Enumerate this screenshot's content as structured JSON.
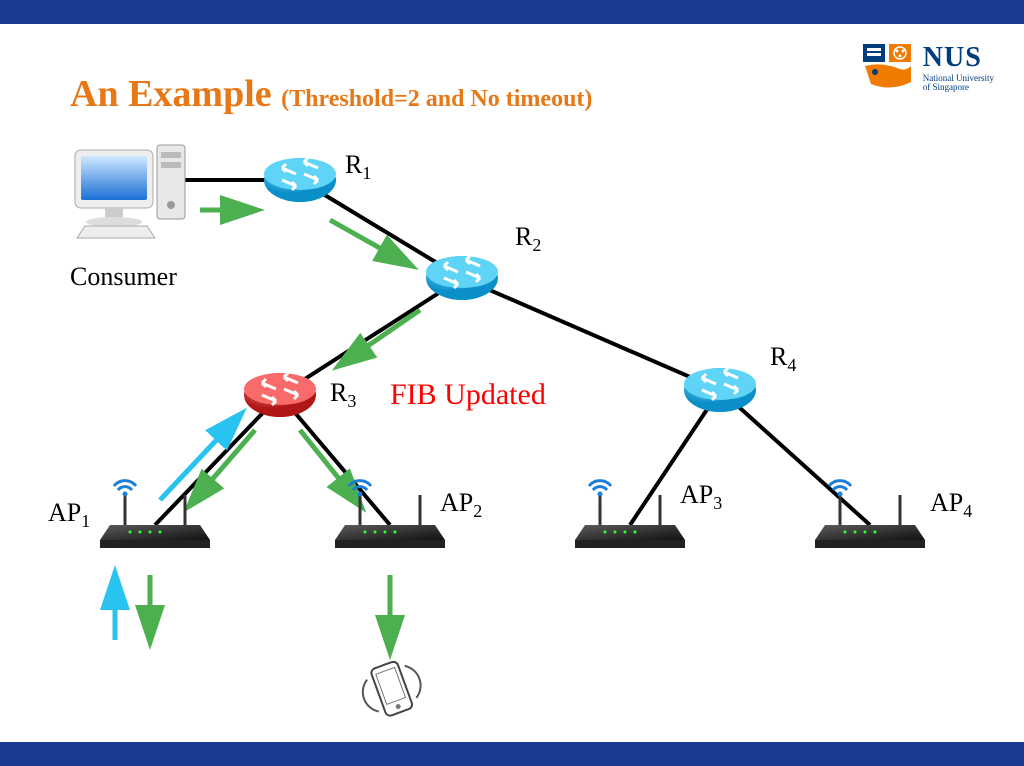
{
  "title": {
    "main": "An Example",
    "sub": "(Threshold=2 and No timeout)"
  },
  "logo": {
    "name": "NUS",
    "sub1": "National University",
    "sub2": "of Singapore"
  },
  "labels": {
    "consumer": "Consumer",
    "r1": "R",
    "r1s": "1",
    "r2": "R",
    "r2s": "2",
    "r3": "R",
    "r3s": "3",
    "r4": "R",
    "r4s": "4",
    "ap1": "AP",
    "ap1s": "1",
    "ap2": "AP",
    "ap2s": "2",
    "ap3": "AP",
    "ap3s": "3",
    "ap4": "AP",
    "ap4s": "4",
    "fib": "FIB Updated"
  },
  "colors": {
    "routerBlue": "#2bb4e6",
    "routerRed": "#d92f2f",
    "arrowGreen": "#4caf50",
    "arrowCyan": "#29c3ef",
    "bar": "#1a3a8f",
    "titleOrange": "#e67817"
  }
}
